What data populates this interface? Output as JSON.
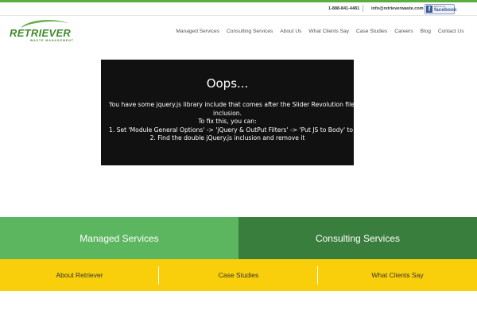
{
  "topbar": {
    "phone": "1-888-841-4481",
    "email": "info@retrieverwaste.com",
    "facebook": {
      "find_text": "Find us on",
      "word": "facebook"
    }
  },
  "logo": {
    "word": "RETRIEVER",
    "sub": "WASTE MANAGEMENT"
  },
  "nav": {
    "items": [
      {
        "label": "Managed Services"
      },
      {
        "label": "Consulting Services"
      },
      {
        "label": "About Us"
      },
      {
        "label": "What Clients Say"
      },
      {
        "label": "Case Studies"
      },
      {
        "label": "Careers"
      },
      {
        "label": "Blog"
      },
      {
        "label": "Contact Us"
      }
    ]
  },
  "error": {
    "title": "Oops...",
    "lines": [
      "You have some jquery.js library include that comes after the Slider Revolution files js",
      "inclusion.",
      "To fix this, you can:",
      "1. Set 'Module General Options' -> 'jQuery & OutPut Filters' -> 'Put JS to Body' to on",
      "2. Find the double jQuery.js inclusion and remove it"
    ]
  },
  "tiles": [
    {
      "label": "Managed Services",
      "color": "#5cb55f"
    },
    {
      "label": "Consulting Services",
      "color": "#3a7e3d"
    }
  ],
  "links": [
    {
      "label": "About Retriever"
    },
    {
      "label": "Case Studies"
    },
    {
      "label": "What Clients Say"
    }
  ],
  "colors": {
    "accent": "#5aad3e",
    "yellow": "#f8cf0a",
    "error_bg": "#111111"
  }
}
